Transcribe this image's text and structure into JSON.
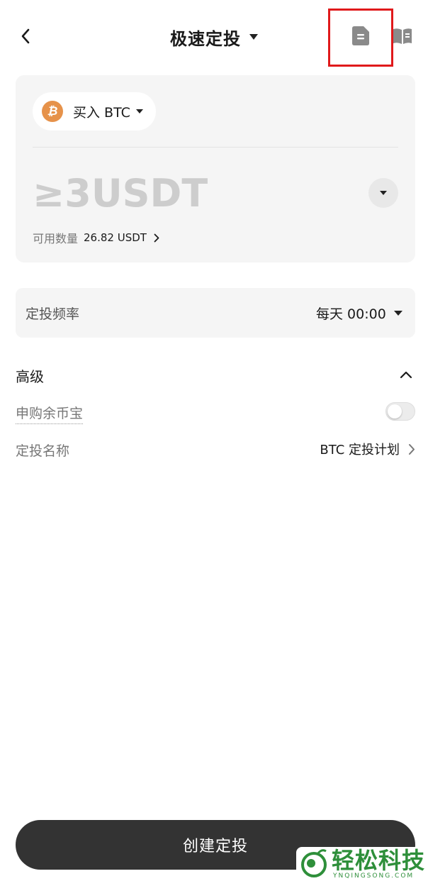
{
  "header": {
    "title": "极速定投",
    "back_icon": "chevron-left-icon",
    "record_icon": "document-icon",
    "guide_icon": "book-icon"
  },
  "highlight_color": "#e0191b",
  "buy": {
    "label": "买入 BTC",
    "coin_symbol": "₿",
    "coin_color": "#e6924a"
  },
  "amount": {
    "placeholder": "≥3USDT"
  },
  "available": {
    "label": "可用数量",
    "value": "26.82 USDT"
  },
  "frequency": {
    "label": "定投频率",
    "value": "每天 00:00"
  },
  "advanced": {
    "label": "高级",
    "subscribe_label": "申购余币宝",
    "subscribe_on": false,
    "plan_name_label": "定投名称",
    "plan_name_value": "BTC 定投计划"
  },
  "create_button": "创建定投",
  "watermark": {
    "text": "轻松科技",
    "url_text": "YNQINGSONG.COM"
  }
}
